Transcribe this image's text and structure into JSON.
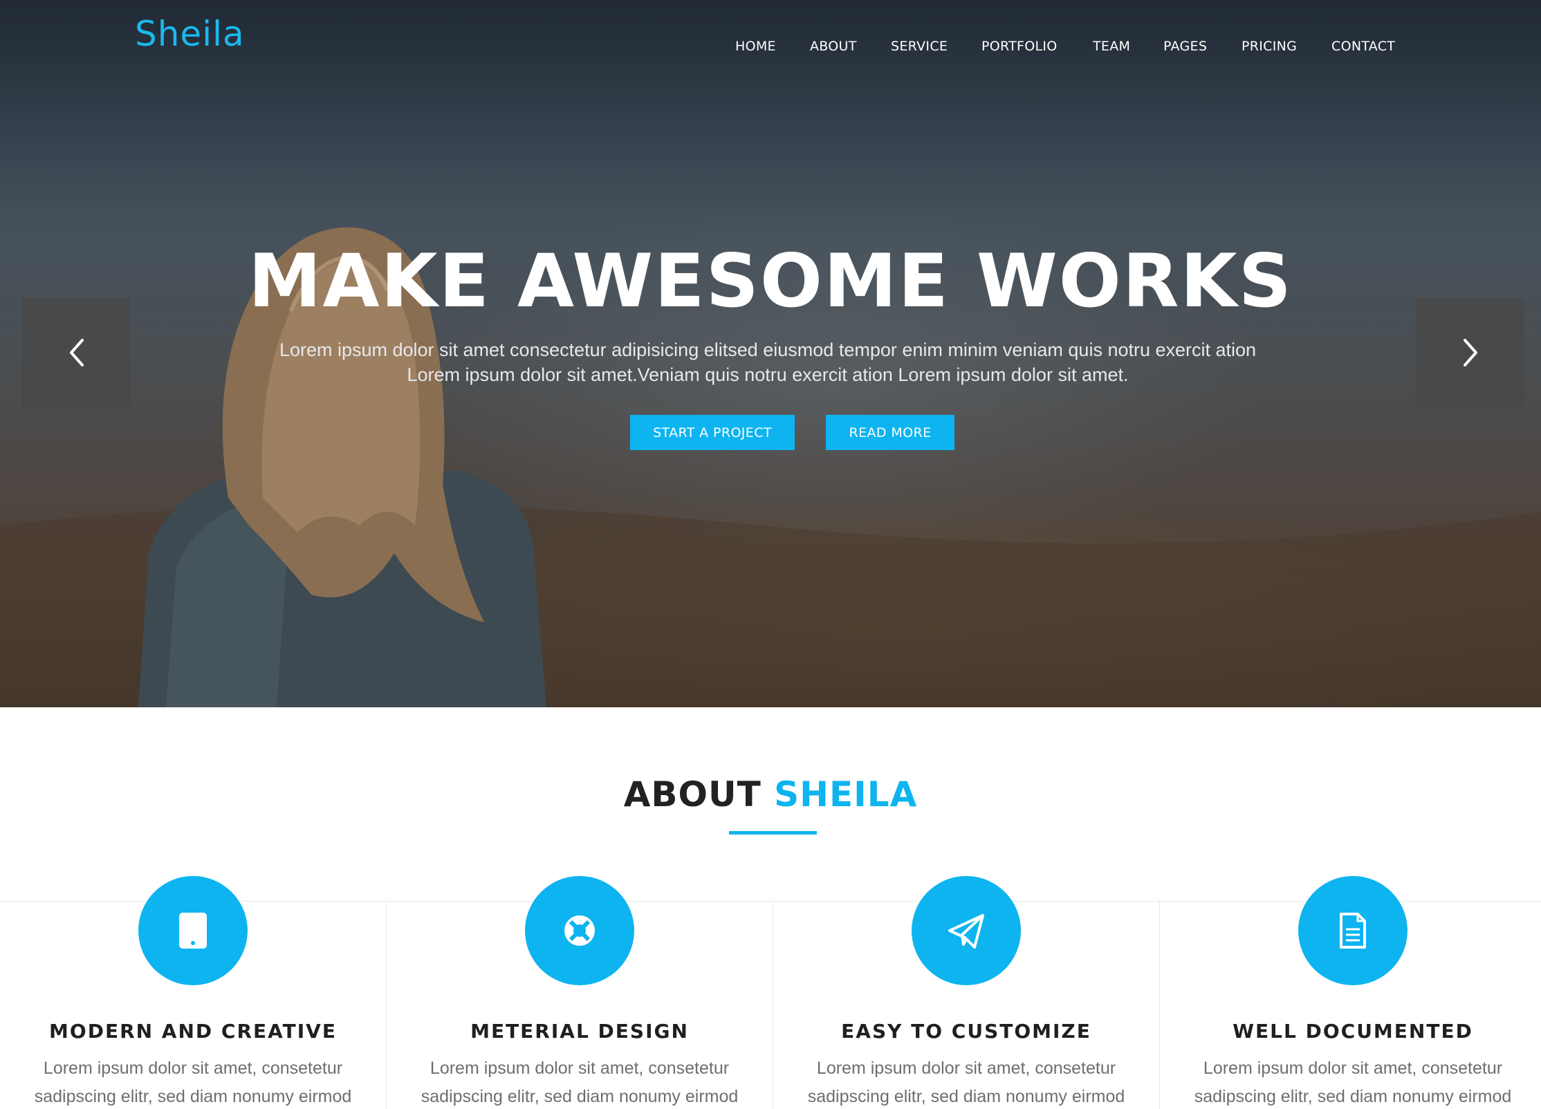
{
  "brand": {
    "logo": "Sheila",
    "accent_color": "#0db4f0"
  },
  "nav": {
    "items": [
      "HOME",
      "ABOUT",
      "SERVICE",
      "PORTFOLIO",
      "TEAM",
      "PAGES",
      "PRICING",
      "CONTACT"
    ]
  },
  "hero": {
    "title": "MAKE AWESOME WORKS",
    "text": "Lorem ipsum dolor sit amet consectetur adipisicing elitsed eiusmod tempor enim minim veniam quis notru exercit ation Lorem ipsum dolor sit amet.Veniam quis notru exercit ation Lorem ipsum dolor sit amet.",
    "primary_button": "START A PROJECT",
    "secondary_button": "READ MORE",
    "prev_icon": "chevron-left-icon",
    "next_icon": "chevron-right-icon"
  },
  "about": {
    "title_prefix": "ABOUT",
    "title_accent": "SHEILA",
    "features": [
      {
        "icon": "tablet-icon",
        "title": "MODERN AND CREATIVE",
        "text": "Lorem ipsum dolor sit amet, consetetur sadipscing elitr, sed diam nonumy eirmod"
      },
      {
        "icon": "life-ring-icon",
        "title": "METERIAL DESIGN",
        "text": "Lorem ipsum dolor sit amet, consetetur sadipscing elitr, sed diam nonumy eirmod"
      },
      {
        "icon": "paper-plane-icon",
        "title": "EASY TO CUSTOMIZE",
        "text": "Lorem ipsum dolor sit amet, consetetur sadipscing elitr, sed diam nonumy eirmod"
      },
      {
        "icon": "document-icon",
        "title": "WELL DOCUMENTED",
        "text": "Lorem ipsum dolor sit amet, consetetur sadipscing elitr, sed diam nonumy eirmod"
      }
    ]
  }
}
